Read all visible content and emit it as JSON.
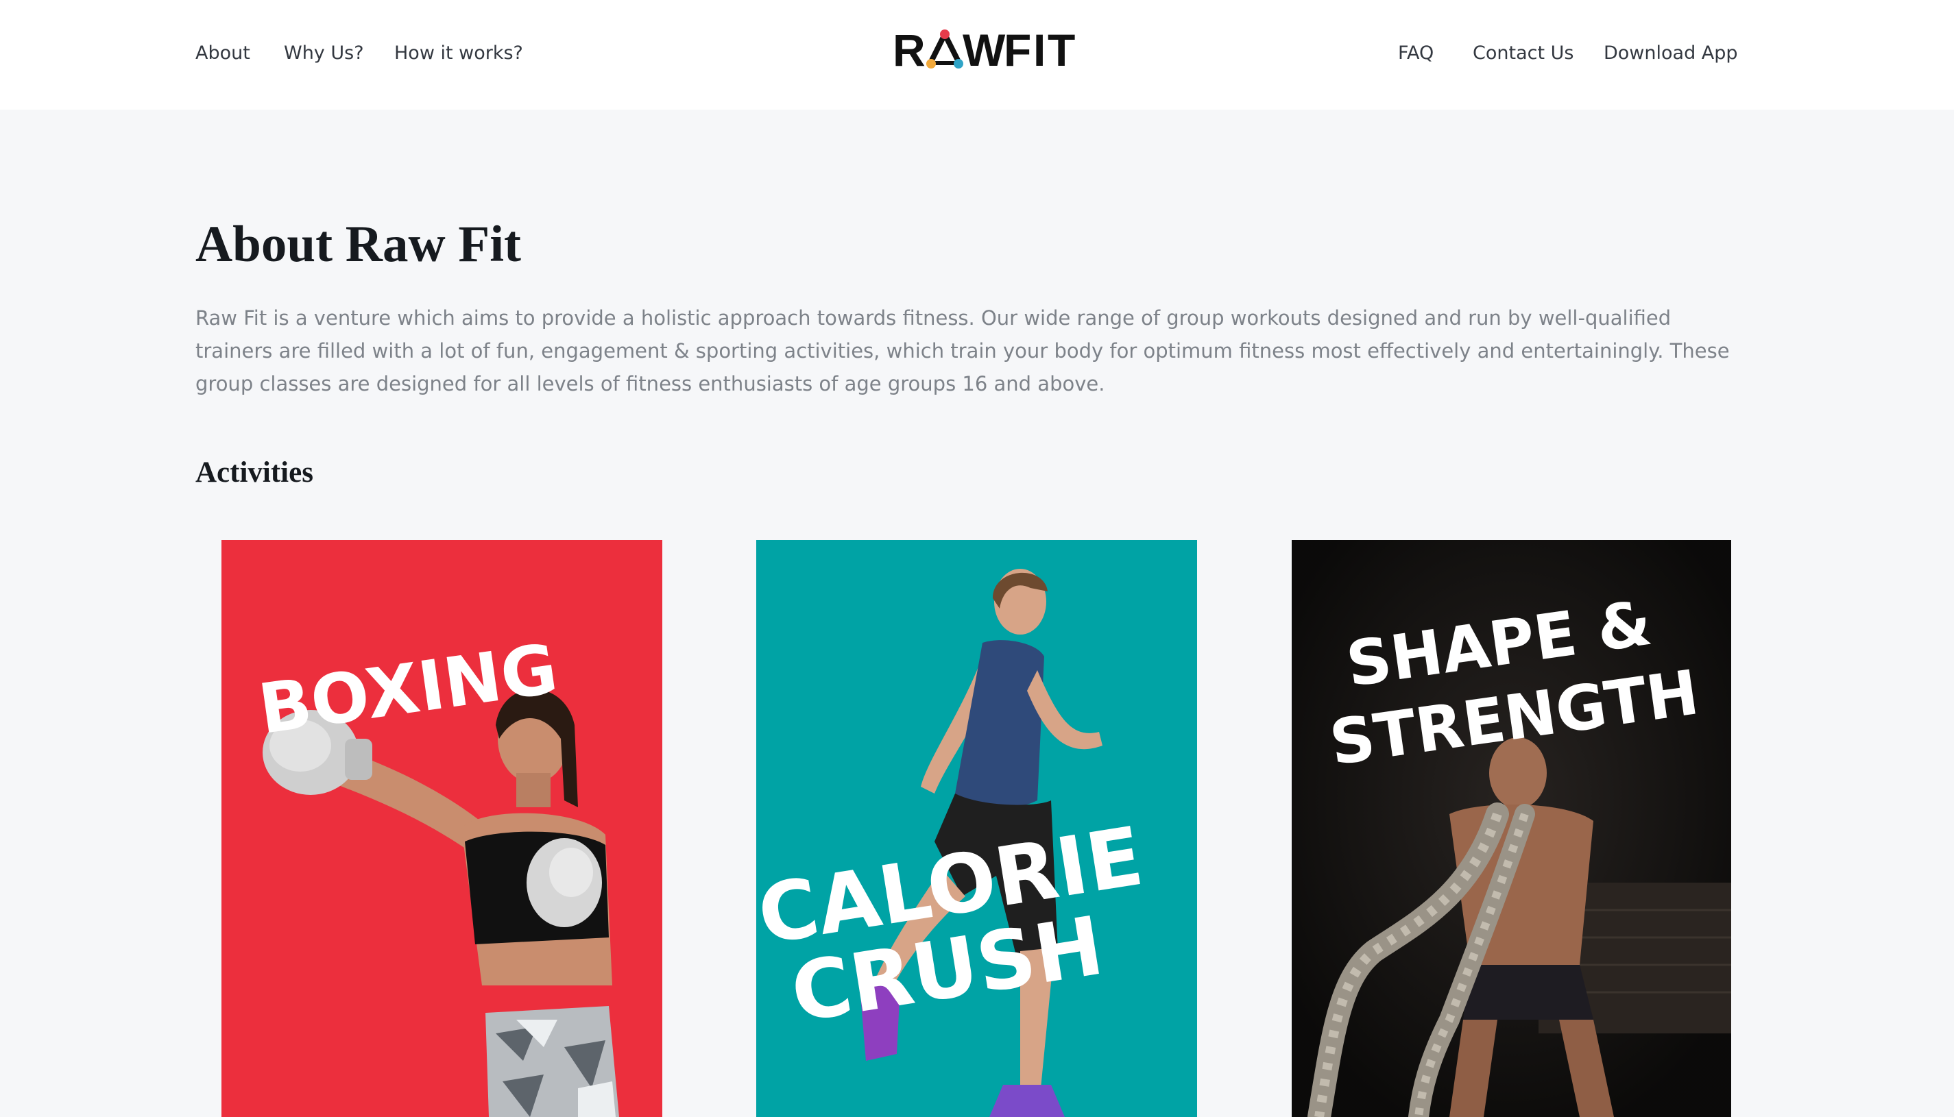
{
  "nav": {
    "left": [
      "About",
      "Why Us?",
      "How it works?"
    ],
    "right": [
      "FAQ",
      "Contact Us",
      "Download App"
    ]
  },
  "brand": {
    "logo_letters": [
      "R",
      "W",
      "F",
      "I",
      "T"
    ],
    "logo_accent_colors": [
      "#e63b4b",
      "#f2a93b",
      "#2fa4c7"
    ]
  },
  "about": {
    "title": "About Raw Fit",
    "description": "Raw Fit is a venture which aims to provide a holistic approach towards fitness. Our wide range of group workouts designed and run by well-qualified trainers are filled with a lot of fun, engagement & sporting activities, which train your body for optimum fitness most effectively and entertainingly. These group classes are designed for all levels of fitness enthusiasts of age groups 16 and above."
  },
  "activities": {
    "heading": "Activities",
    "cards": [
      {
        "title_lines": [
          "BOXING"
        ],
        "background": "#ec2f3d",
        "icon": "boxing-glove-icon"
      },
      {
        "title_lines": [
          "CALORIE",
          "CRUSH"
        ],
        "background": "#00a3a5",
        "icon": "runner-icon"
      },
      {
        "title_lines": [
          "SHAPE &",
          "STRENGTH"
        ],
        "background": "#111111",
        "icon": "battle-rope-icon"
      }
    ]
  }
}
